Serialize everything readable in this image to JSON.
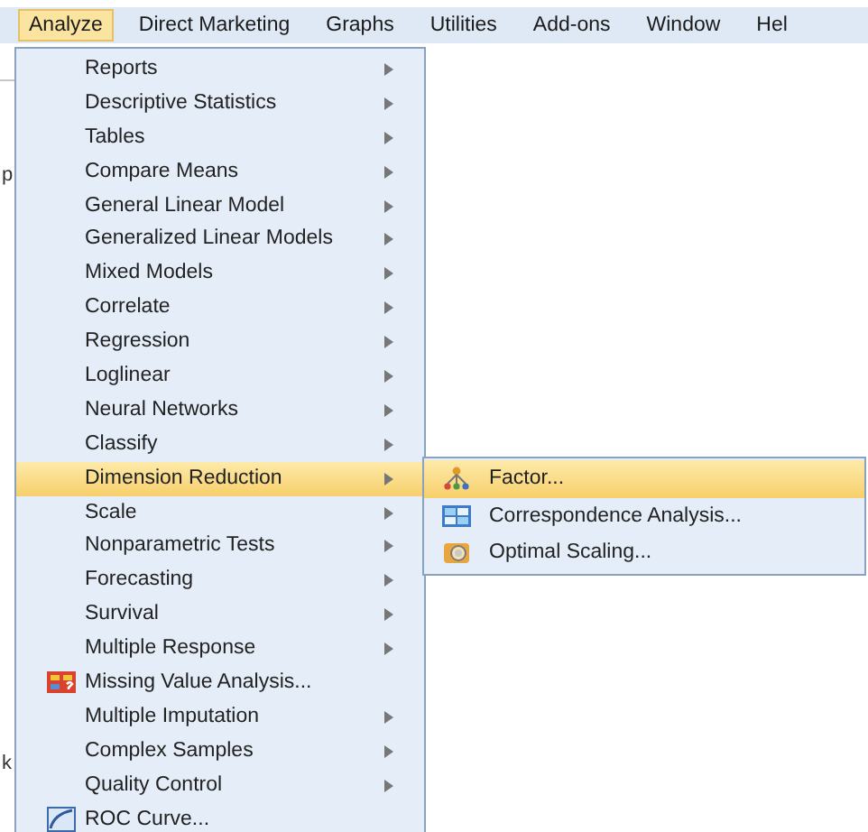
{
  "menubar": [
    {
      "label": "Analyze",
      "selected": true
    },
    {
      "label": "Direct Marketing",
      "selected": false
    },
    {
      "label": "Graphs",
      "selected": false
    },
    {
      "label": "Utilities",
      "selected": false
    },
    {
      "label": "Add-ons",
      "selected": false
    },
    {
      "label": "Window",
      "selected": false
    },
    {
      "label": "Hel",
      "selected": false
    }
  ],
  "background_fragments": [
    "p",
    "k"
  ],
  "menu": [
    {
      "label": "Reports",
      "kind": "submenu",
      "selected": false
    },
    {
      "label": "Descriptive Statistics",
      "kind": "submenu",
      "selected": false
    },
    {
      "label": "Tables",
      "kind": "submenu",
      "selected": false
    },
    {
      "label": "Compare Means",
      "kind": "submenu",
      "selected": false
    },
    {
      "label": "General Linear Model",
      "kind": "submenu",
      "selected": false
    },
    {
      "label": "Generalized Linear Models",
      "kind": "submenu",
      "selected": false
    },
    {
      "label": "Mixed Models",
      "kind": "submenu",
      "selected": false
    },
    {
      "label": "Correlate",
      "kind": "submenu",
      "selected": false
    },
    {
      "label": "Regression",
      "kind": "submenu",
      "selected": false
    },
    {
      "label": "Loglinear",
      "kind": "submenu",
      "selected": false
    },
    {
      "label": "Neural Networks",
      "kind": "submenu",
      "selected": false
    },
    {
      "label": "Classify",
      "kind": "submenu",
      "selected": false
    },
    {
      "label": "Dimension Reduction",
      "kind": "submenu",
      "selected": true
    },
    {
      "label": "Scale",
      "kind": "submenu",
      "selected": false
    },
    {
      "label": "Nonparametric Tests",
      "kind": "submenu",
      "selected": false
    },
    {
      "label": "Forecasting",
      "kind": "submenu",
      "selected": false
    },
    {
      "label": "Survival",
      "kind": "submenu",
      "selected": false
    },
    {
      "label": "Multiple Response",
      "kind": "submenu",
      "selected": false
    },
    {
      "label": "Missing Value Analysis...",
      "kind": "dialog",
      "selected": false
    },
    {
      "label": "Multiple Imputation",
      "kind": "submenu",
      "selected": false
    },
    {
      "label": "Complex Samples",
      "kind": "submenu",
      "selected": false
    },
    {
      "label": "Quality Control",
      "kind": "submenu",
      "selected": false
    },
    {
      "label": "ROC Curve...",
      "kind": "dialog",
      "selected": false
    }
  ],
  "submenu": [
    {
      "label": "Factor...",
      "selected": true
    },
    {
      "label": "Correspondence Analysis...",
      "selected": false
    },
    {
      "label": "Optimal Scaling...",
      "selected": false
    }
  ]
}
